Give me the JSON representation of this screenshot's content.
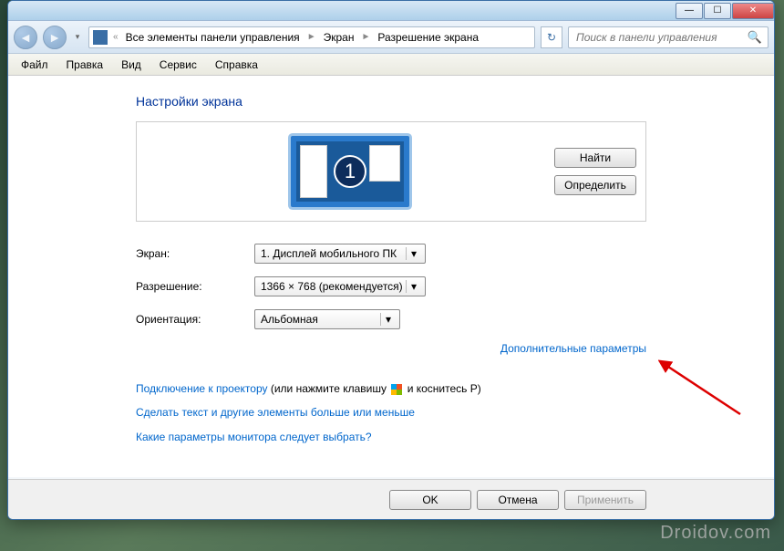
{
  "breadcrumb": {
    "items": [
      "Все элементы панели управления",
      "Экран",
      "Разрешение экрана"
    ]
  },
  "search": {
    "placeholder": "Поиск в панели управления"
  },
  "menu": {
    "file": "Файл",
    "edit": "Правка",
    "view": "Вид",
    "service": "Сервис",
    "help": "Справка"
  },
  "page": {
    "title": "Настройки экрана",
    "monitor_number": "1",
    "find_btn": "Найти",
    "identify_btn": "Определить"
  },
  "form": {
    "display_label": "Экран:",
    "display_value": "1. Дисплей мобильного ПК",
    "resolution_label": "Разрешение:",
    "resolution_value": "1366 × 768 (рекомендуется)",
    "orientation_label": "Ориентация:",
    "orientation_value": "Альбомная"
  },
  "links": {
    "advanced": "Дополнительные параметры",
    "projector_link": "Подключение к проектору",
    "projector_text1": " (или нажмите клавишу ",
    "projector_text2": " и коснитесь P)",
    "textsize": "Сделать текст и другие элементы больше или меньше",
    "which_settings": "Какие параметры монитора следует выбрать?"
  },
  "footer": {
    "ok": "OK",
    "cancel": "Отмена",
    "apply": "Применить"
  },
  "watermark": "Droidov.com"
}
